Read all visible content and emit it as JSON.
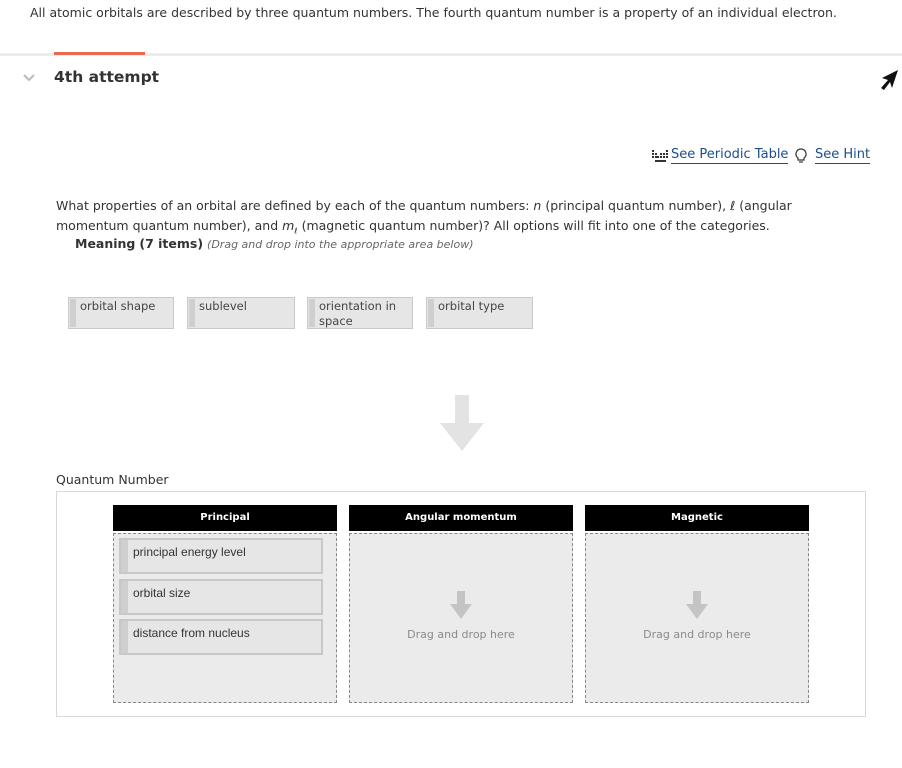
{
  "intro_text": "All atomic orbitals are described by three quantum numbers. The fourth quantum number is a property of an individual electron.",
  "attempt": {
    "title": "4th attempt"
  },
  "tools": {
    "periodic_table": "See Periodic Table",
    "hint": "See Hint"
  },
  "question": {
    "part1": "What properties of an orbital are defined by each of the quantum numbers: ",
    "n": "n",
    "part2": " (principal quantum number), ",
    "l": "ℓ",
    "part3": " (angular momentum quantum number), and ",
    "ml": "m",
    "ml_sub": "ℓ",
    "part4": " (magnetic quantum number)? All options will fit into one of the categories."
  },
  "meaning": {
    "label": "Meaning",
    "count": "(7 items)",
    "instruction": "(Drag and drop into the appropriate area below)"
  },
  "draggable_items": [
    {
      "line1": "orbital shape",
      "line2": ""
    },
    {
      "line1": "sublevel",
      "line2": ""
    },
    {
      "line1": "orientation in",
      "line2": "space"
    },
    {
      "line1": "orbital type",
      "line2": ""
    }
  ],
  "quantum_number_label": "Quantum Number",
  "columns": [
    {
      "header": "Principal",
      "items": [
        "principal energy level",
        "orbital size",
        "distance from nucleus"
      ],
      "placeholder": ""
    },
    {
      "header": "Angular momentum",
      "items": [],
      "placeholder": "Drag and drop here"
    },
    {
      "header": "Magnetic",
      "items": [],
      "placeholder": "Drag and drop here"
    }
  ],
  "colors": {
    "accent": "#e66a4e",
    "link": "#1a4f8b",
    "header_bg": "#000000"
  },
  "icons": {
    "chevron": "chevron-down-icon",
    "periodic": "periodic-table-icon",
    "hint": "lightbulb-icon",
    "arrow": "arrow-down-icon",
    "cursor": "cursor-arrow-icon"
  }
}
